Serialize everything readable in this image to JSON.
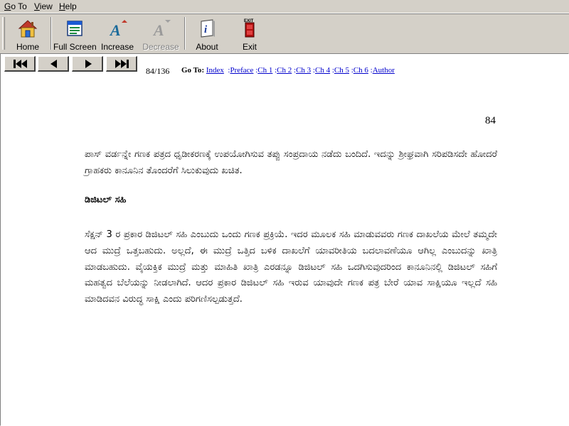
{
  "menu": {
    "goto": "Go To",
    "view": "View",
    "help": "Help"
  },
  "toolbar": {
    "home": "Home",
    "fullscreen": "Full Screen",
    "increase": "Increase",
    "decrease": "Decrease",
    "about": "About",
    "exit": "Exit",
    "exit_icon_text": "EXIT"
  },
  "nav": {
    "page_counter": "84/136",
    "goto_label": "Go To",
    "links": {
      "index": "Index",
      "preface": "Preface",
      "ch1": "Ch 1",
      "ch2": "Ch 2",
      "ch3": "Ch 3",
      "ch4": "Ch 4",
      "ch5": "Ch 5",
      "ch6": "Ch 6",
      "author": "Author"
    }
  },
  "page": {
    "number": "84",
    "para1": "ಪಾಸ್ ವರ್ಡನ್ನೇ ಗಣಕ ಪತ್ರದ ಧೃಡೀಕರಣಕ್ಕೆ ಉಪಯೋಗಿಸುವ ತಪ್ಪು ಸಂಪ್ರದಾಯ ನಡೆದು ಬಂದಿದೆ. ಇದನ್ನು ಶ್ರೀಘ್ರವಾಗಿ ಸರಿಪಡಿಸದೇ ಹೋದರೆ ಗ್ರಾಹಕರು ಕಾನೂನಿನ ತೊಂದರೆಗೆ ಸಿಲುಕುವುದು ಖಚಿತ.",
    "heading": "ಡಿಜಿಟಲ್ ಸಹಿ",
    "para2": "ಸೆಕ್ಷನ್ 3 ರ ಪ್ರಕಾರ ಡಿಜಿಟಲ್ ಸಹಿ ಎಂಬುದು ಒಂದು ಗಣಕ ಪ್ರಕ್ರಿಯೆ. ಇದರ ಮೂಲಕ ಸಹಿ ಮಾಡುವವರು ಗಣಕ ದಾಖಲೆಯ ಮೇಲೆ ತಮ್ಮದೇ ಆದ ಮುದ್ರೆ ಒತ್ತಬಹುದು. ಅಲ್ಲದೆ, ಈ ಮುದ್ರೆ ಒತ್ತಿದ ಬಳಿಕ ದಾಖಲೆಗೆ ಯಾವರೀತಿಯ ಬದಲಾವಣೆಯೂ ಆಗಿಲ್ಲ ಎಂಬುದನ್ನು ಖಾತ್ರಿ ಮಾಡಬಹುದು. ವೈಯಕ್ತಿಕ ಮುದ್ರೆ ಮತ್ತು ಮಾಹಿತಿ ಖಾತ್ರಿ ಎರಡನ್ನೂ ಡಿಜಿಟಲ್ ಸಹಿ ಒದಗಿಸುವುದರಿಂದ ಕಾನೂನಿನಲ್ಲಿ ಡಿಜಿಟಲ್ ಸಹಿಗೆ ಮಹತ್ವದ ಬೆಲೆಯನ್ನು ನೀಡಲಾಗಿದೆ. ಆದರ ಪ್ರಕಾರ ಡಿಜಿಟಲ್ ಸಹಿ ಇರುವ ಯಾವುದೇ ಗಣಕ ಪತ್ರ ಬೇರೆ ಯಾವ ಸಾಕ್ಷಿಯೂ ಇಲ್ಲದೆ ಸಹಿ ಮಾಡಿದವನ ವಿರುದ್ಧ ಸಾಕ್ಷಿ ಎಂದು ಪರಿಗಣಿಸಲ್ಪಡುತ್ತದೆ."
  },
  "icons": {
    "home": "home-icon",
    "fullscreen": "window-icon",
    "increase": "font-increase-icon",
    "decrease": "font-decrease-icon",
    "about": "info-icon",
    "exit": "exit-door-icon",
    "first": "first-page-icon",
    "prev": "prev-page-icon",
    "next": "next-page-icon",
    "last": "last-page-icon"
  },
  "colors": {
    "chrome": "#d4d0c8",
    "link": "#0000cc",
    "content_bg": "#ffffff"
  }
}
